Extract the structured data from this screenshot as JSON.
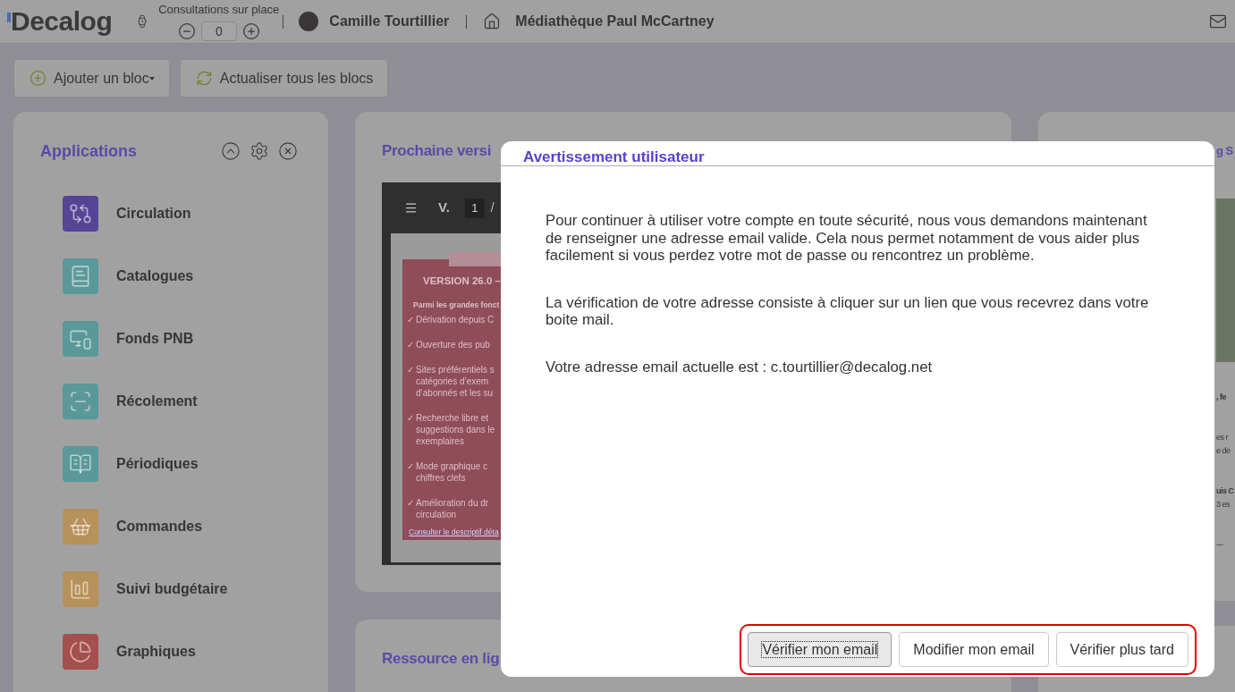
{
  "header": {
    "logo": "Decalog",
    "consultations": {
      "label": "Consultations sur place",
      "value": "0"
    },
    "user": "Camille Tourtillier",
    "library": "Médiathèque Paul McCartney"
  },
  "toolbar": [
    {
      "label": "Ajouter un bloc",
      "kind": "add",
      "menu": true
    },
    {
      "label": "Actualiser tous les blocs",
      "kind": "refresh",
      "menu": false
    }
  ],
  "applications": {
    "title": "Applications",
    "items": [
      {
        "label": "Circulation",
        "kind": "circulation",
        "color": "#564596"
      },
      {
        "label": "Catalogues",
        "kind": "catalogue",
        "color": "#5b9899"
      },
      {
        "label": "Fonds PNB",
        "kind": "devices",
        "color": "#5b9899"
      },
      {
        "label": "Récolement",
        "kind": "scan",
        "color": "#5b9899"
      },
      {
        "label": "Périodiques",
        "kind": "book",
        "color": "#5b9899"
      },
      {
        "label": "Commandes",
        "kind": "basket",
        "color": "#b6915b"
      },
      {
        "label": "Suivi budgétaire",
        "kind": "budget",
        "color": "#b6915b"
      },
      {
        "label": "Graphiques",
        "kind": "pie",
        "color": "#a64f4f"
      }
    ]
  },
  "version_card": {
    "title": "Prochaine versi",
    "viewer": {
      "document_title": "V.",
      "page": "1",
      "page_separator": "/",
      "poster": {
        "heading": "VERSION 26.0 –",
        "intro": "Parmi les grandes fonct",
        "items": [
          {
            "mark": "✓",
            "lines": [
              "Dérivation depuis C"
            ]
          },
          {
            "mark": "✓",
            "lines": [
              "Ouverture des pub"
            ]
          },
          {
            "mark": "✓",
            "lines": [
              "Sites préférentiels s",
              "catégories d’exem",
              "d’abonnés et les su"
            ]
          },
          {
            "mark": "✓",
            "lines": [
              "Recherche libre et",
              "suggestions dans le",
              "exemplaires"
            ]
          },
          {
            "mark": "✓",
            "lines": [
              "Mode graphique c",
              "chiffres clefs"
            ]
          },
          {
            "mark": "✓",
            "lines": [
              "Amélioration du dr",
              "circulation"
            ]
          }
        ],
        "link": "Consulter le descriptif déta"
      }
    }
  },
  "resource_card": {
    "title": "Ressource en lig"
  },
  "right_card": {
    "title": "g S",
    "blocks": [
      {
        "lines": [
          {
            "text": ", fe",
            "bold": true
          }
        ]
      },
      {
        "lines": [
          {
            "text": "es r",
            "bold": false
          },
          {
            "text": "e de",
            "bold": false
          }
        ]
      },
      {
        "lines": [
          {
            "text": "uis C",
            "bold": true
          },
          {
            "text": "3 es",
            "bold": false
          }
        ]
      },
      {
        "lines": [
          {
            "text": "---",
            "bold": false
          }
        ]
      }
    ]
  },
  "dialog": {
    "title": "Avertissement utilisateur",
    "paragraphs": [
      "Pour continuer à utiliser votre compte en toute sécurité, nous vous demandons maintenant de renseigner une adresse email valide. Cela nous permet notamment de vous aider plus facilement si vous perdez votre mot de passe ou rencontrez un problème.",
      "La vérification de votre adresse consiste à cliquer sur un lien que vous recevrez dans votre boite mail.",
      "Votre adresse email actuelle est : c.tourtillier@decalog.net"
    ],
    "buttons": [
      {
        "label": "Vérifier mon email",
        "focused": true
      },
      {
        "label": "Modifier mon email",
        "focused": false
      },
      {
        "label": "Vérifier plus tard",
        "focused": false
      }
    ]
  }
}
